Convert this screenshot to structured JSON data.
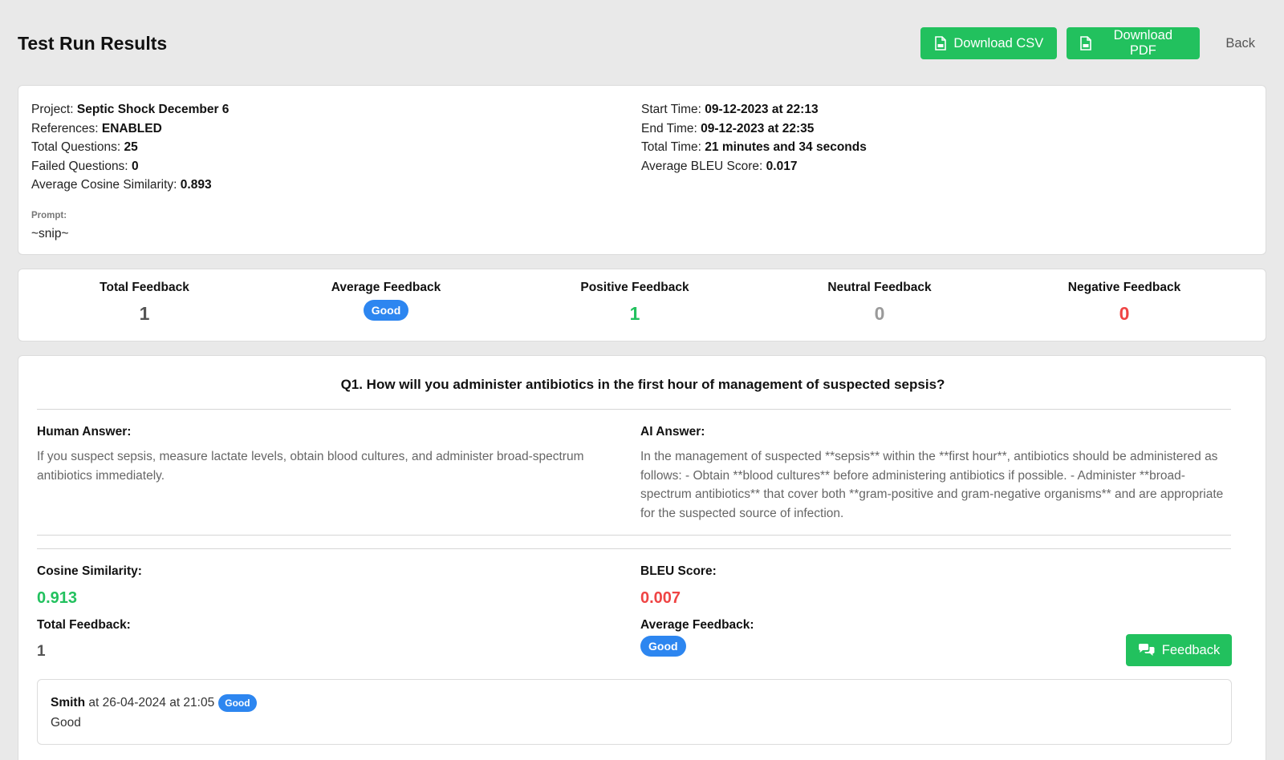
{
  "header": {
    "title": "Test Run Results",
    "download_csv": "Download CSV",
    "download_pdf": "Download PDF",
    "back": "Back"
  },
  "info": {
    "project_label": "Project:",
    "project": "Septic Shock December 6",
    "references_label": "References:",
    "references": "ENABLED",
    "total_questions_label": "Total Questions:",
    "total_questions": "25",
    "failed_questions_label": "Failed Questions:",
    "failed_questions": "0",
    "avg_cosine_label": "Average Cosine Similarity:",
    "avg_cosine": "0.893",
    "start_time_label": "Start Time:",
    "start_time": "09-12-2023 at 22:13",
    "end_time_label": "End Time:",
    "end_time": "09-12-2023 at 22:35",
    "total_time_label": "Total Time:",
    "total_time": "21 minutes and 34 seconds",
    "avg_bleu_label": "Average BLEU Score:",
    "avg_bleu": "0.017",
    "prompt_label": "Prompt:",
    "prompt": "~snip~"
  },
  "stats": {
    "total_label": "Total Feedback",
    "total": "1",
    "average_label": "Average Feedback",
    "average": "Good",
    "positive_label": "Positive Feedback",
    "positive": "1",
    "neutral_label": "Neutral Feedback",
    "neutral": "0",
    "negative_label": "Negative Feedback",
    "negative": "0"
  },
  "question": {
    "title": "Q1. How will you administer antibiotics in the first hour of management of suspected sepsis?",
    "human_label": "Human Answer:",
    "human_answer": "If you suspect sepsis, measure lactate levels, obtain blood cultures, and administer broad-spectrum antibiotics immediately.",
    "ai_label": "AI Answer:",
    "ai_answer": "In the management of suspected **sepsis** within the **first hour**, antibiotics should be administered as follows: - Obtain **blood cultures** before administering antibiotics if possible. - Administer **broad-spectrum antibiotics** that cover both **gram-positive and gram-negative organisms** and are appropriate for the suspected source of infection.",
    "cosine_label": "Cosine Similarity:",
    "cosine": "0.913",
    "bleu_label": "BLEU Score:",
    "bleu": "0.007",
    "total_feedback_label": "Total Feedback:",
    "total_feedback": "1",
    "avg_feedback_label": "Average Feedback:",
    "avg_feedback": "Good",
    "feedback_button": "Feedback",
    "feedback_entries": [
      {
        "user": "Smith",
        "when": "at 26-04-2024 at 21:05",
        "rating": "Good",
        "comment": "Good"
      }
    ]
  },
  "colors": {
    "accent_green": "#22c15e",
    "accent_red": "#ef4444",
    "badge_blue": "#2d86f0"
  }
}
